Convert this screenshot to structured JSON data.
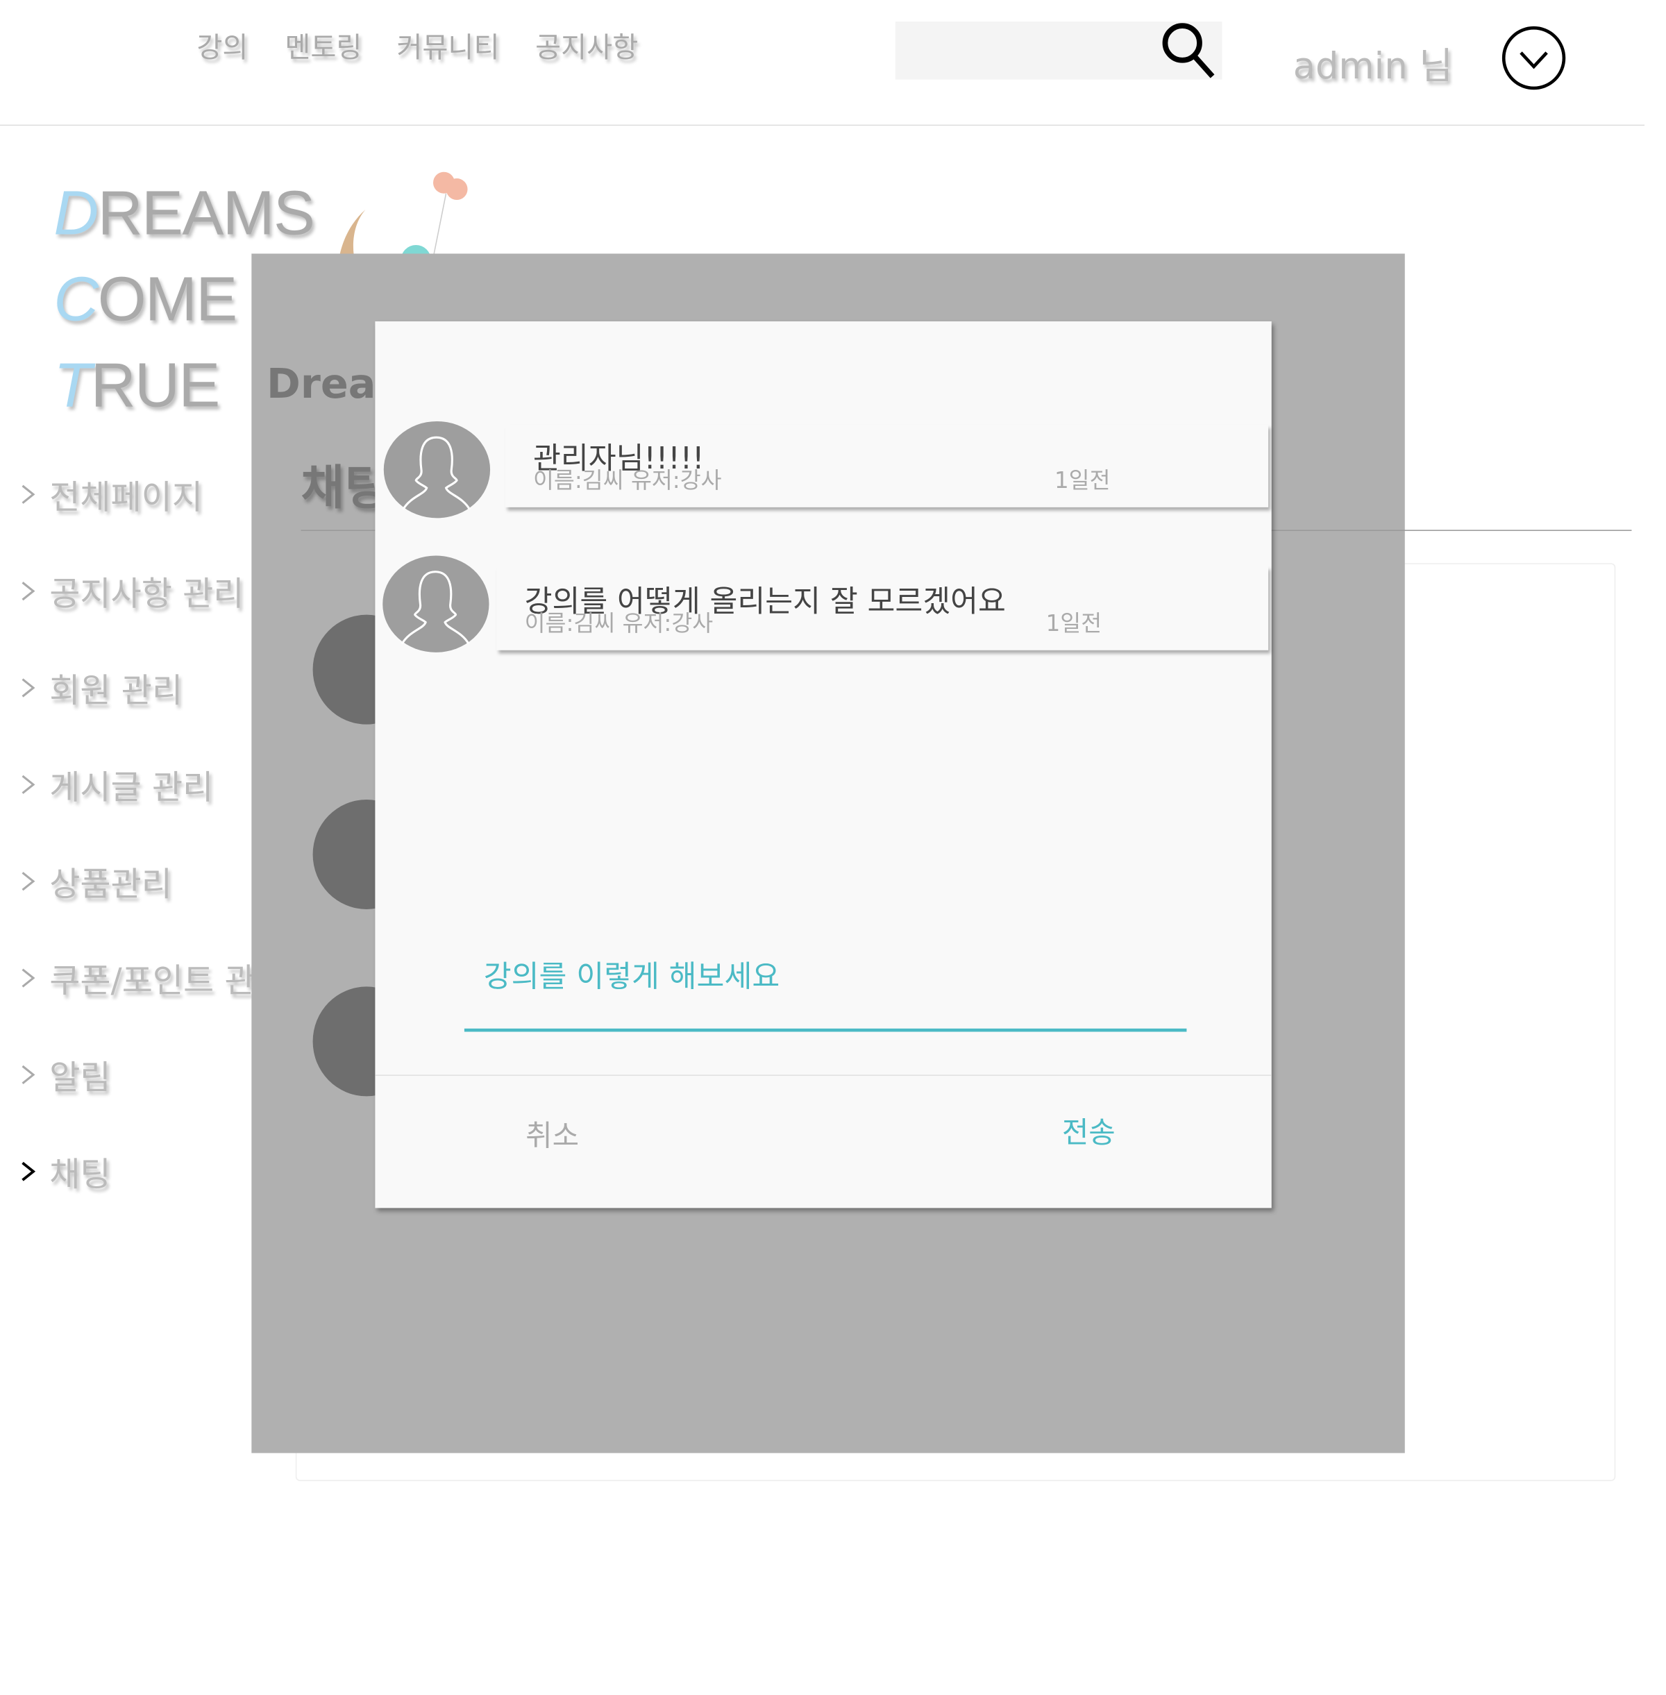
{
  "header": {
    "nav": [
      "강의",
      "멘토링",
      "커뮤니티",
      "공지사항"
    ],
    "search": {
      "placeholder": "",
      "icon": "search-icon"
    },
    "user_label": "admin 님",
    "menu_icon": "chevron-down-circle-icon"
  },
  "logo": {
    "line1_first": "D",
    "line1_rest": "REAMS",
    "line2_first": "C",
    "line2_rest": "OME",
    "line3_first": "T",
    "line3_rest": "RUE",
    "brand_partial": "Dream"
  },
  "sidebar": {
    "items": [
      "전체페이지",
      "공지사항 관리",
      "회원 관리",
      "게시글 관리",
      "상품관리",
      "쿠폰/포인트 관리",
      "알림",
      "채팅"
    ],
    "active_index": 7
  },
  "page": {
    "title_partial": "채팅"
  },
  "modal": {
    "messages": [
      {
        "title": "관리자님!!!!!",
        "meta": "이름:김씨 유저:강사",
        "time": "1일전"
      },
      {
        "title": "강의를 어떻게 올리는지 잘 모르겠어요",
        "meta": "이름:김씨 유저:강사",
        "time": "1일전"
      }
    ],
    "reply_value": "강의를 이렇게 해보세요",
    "cancel_label": "취소",
    "send_label": "전송"
  },
  "colors": {
    "accent": "#4bbac5",
    "overlay": "#b0b0b0",
    "logo_accent": "#a9d8f2"
  }
}
